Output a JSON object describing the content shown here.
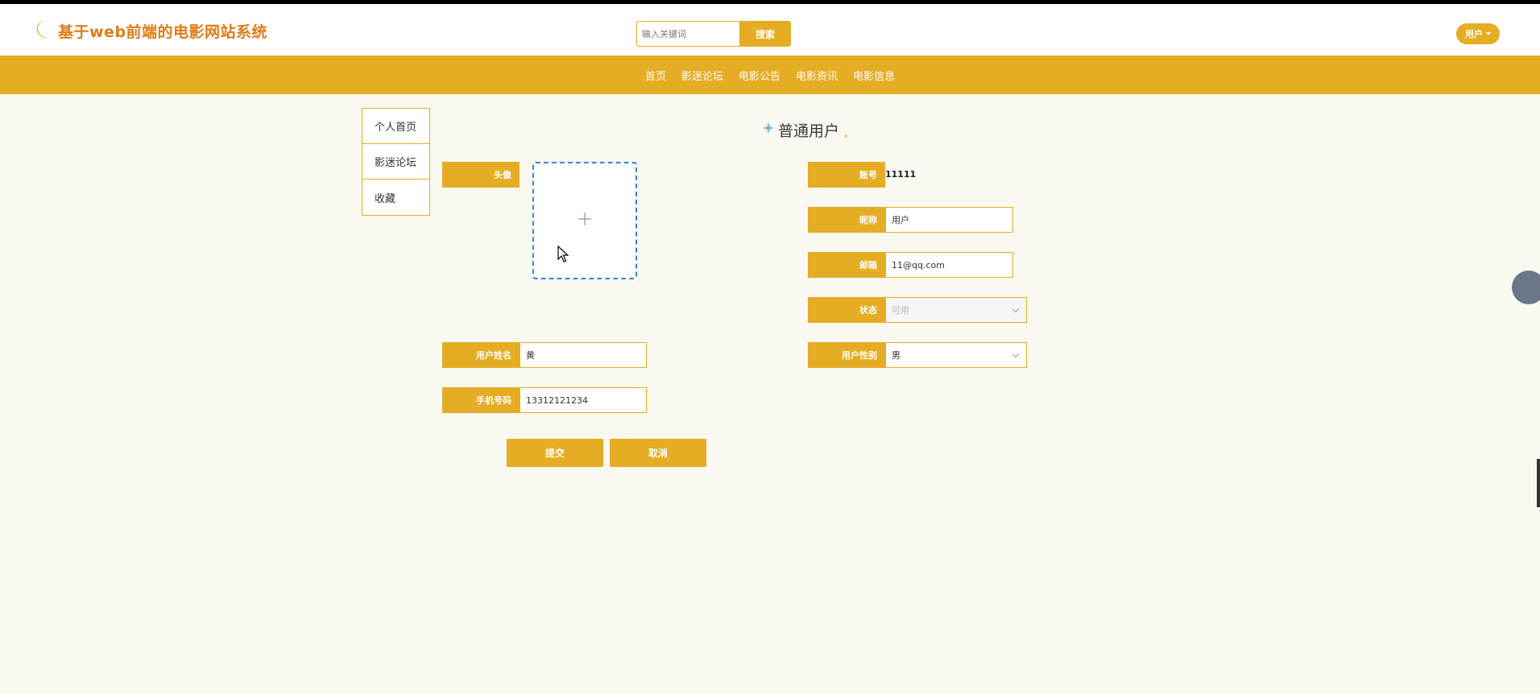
{
  "header": {
    "site_title": "基于web前端的电影网站系统",
    "search": {
      "placeholder": "输入关键词",
      "button_label": "搜索"
    },
    "user_menu_label": "用户"
  },
  "nav": {
    "items": [
      {
        "label": "首页"
      },
      {
        "label": "影迷论坛"
      },
      {
        "label": "电影公告"
      },
      {
        "label": "电影资讯"
      },
      {
        "label": "电影信息"
      }
    ]
  },
  "sidebar": {
    "items": [
      {
        "label": "个人首页"
      },
      {
        "label": "影迷论坛"
      },
      {
        "label": "收藏"
      }
    ]
  },
  "profile": {
    "title": "普通用户",
    "avatar_label": "头像",
    "account": {
      "label": "账号",
      "value": "11111"
    },
    "nickname": {
      "label": "昵称",
      "value": "用户"
    },
    "email": {
      "label": "邮箱",
      "value": "11@qq.com"
    },
    "status": {
      "label": "状态",
      "value": "可用"
    },
    "real_name": {
      "label": "用户姓名",
      "value": "黄"
    },
    "gender": {
      "label": "用户性别",
      "value": "男"
    },
    "phone": {
      "label": "手机号码",
      "value": "13312121234"
    },
    "submit_label": "提交",
    "cancel_label": "取消"
  },
  "colors": {
    "accent": "#e4ad24",
    "title_orange": "#e07b18",
    "background": "#f9f8f1",
    "upload_border": "#3b82d8"
  },
  "icons": [
    "moon-icon",
    "plus-icon",
    "star-icon",
    "chevron-down-icon",
    "caret-down-icon",
    "mouse-cursor-icon"
  ]
}
